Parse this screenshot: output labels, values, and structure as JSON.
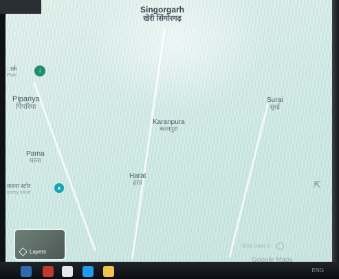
{
  "map": {
    "places": [
      {
        "en": "Singorgarh",
        "hi": "खेरी सिंगोरगढ़",
        "style": "big"
      },
      {
        "en": "Pipariya",
        "hi": "पिपरिया",
        "style": "normal"
      },
      {
        "en": "Surai",
        "hi": "सुरई",
        "style": "normal"
      },
      {
        "en": "Karanpura",
        "hi": "करनपुरा",
        "style": "normal"
      },
      {
        "en": "Parna",
        "hi": "परना",
        "style": "normal"
      },
      {
        "en": "Harat",
        "hi": "हरत",
        "style": "normal"
      }
    ],
    "pois": [
      {
        "text": "ार्क",
        "sub": "Park",
        "icon": "park-pin-icon",
        "color": "#1e8e6e"
      },
      {
        "text": "करना स्टोर",
        "sub": "ocery store",
        "icon": "grocery-store-pin-icon",
        "color": "#12a5b5"
      }
    ]
  },
  "controls": {
    "layers_label": "Layers",
    "attribution_text": "Map data ©",
    "logo_text": "Google Maps"
  },
  "icons": {
    "layers": "layers-icon",
    "cursor": "mouse-cursor-icon"
  },
  "taskbar": {
    "status_text": "ENG"
  }
}
